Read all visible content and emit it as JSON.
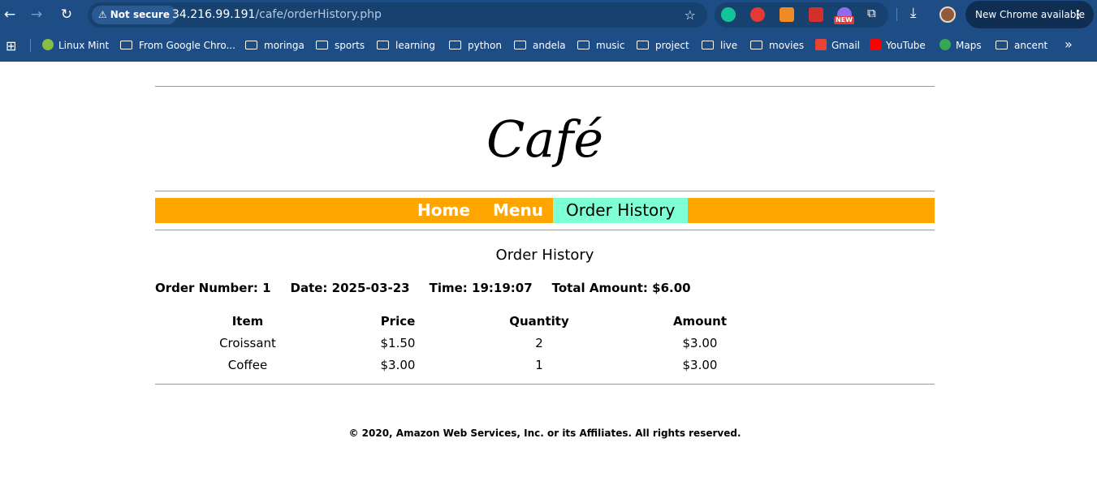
{
  "browser": {
    "security_label": "Not secure",
    "url_host": "34.216.99.191",
    "url_path": "/cafe/orderHistory.php",
    "ext_new_badge": "NEW",
    "update_label": "New Chrome available",
    "bookmarks": [
      {
        "label": "Linux Mint",
        "icon": "linux-mint-icon"
      },
      {
        "label": "From Google Chro...",
        "icon": "folder-icon"
      },
      {
        "label": "moringa",
        "icon": "folder-icon"
      },
      {
        "label": "sports",
        "icon": "folder-icon"
      },
      {
        "label": "learning",
        "icon": "folder-icon"
      },
      {
        "label": "python",
        "icon": "folder-icon"
      },
      {
        "label": "andela",
        "icon": "folder-icon"
      },
      {
        "label": "music",
        "icon": "folder-icon"
      },
      {
        "label": "project",
        "icon": "folder-icon"
      },
      {
        "label": "live",
        "icon": "folder-icon"
      },
      {
        "label": "movies",
        "icon": "folder-icon"
      },
      {
        "label": "Gmail",
        "icon": "gmail-icon"
      },
      {
        "label": "YouTube",
        "icon": "youtube-icon"
      },
      {
        "label": "Maps",
        "icon": "maps-icon"
      },
      {
        "label": "ancent",
        "icon": "folder-icon"
      }
    ]
  },
  "site": {
    "title": "Café",
    "nav": [
      {
        "label": "Home",
        "active": false
      },
      {
        "label": "Menu",
        "active": false
      },
      {
        "label": "Order History",
        "active": true
      }
    ],
    "nav_color": "#ffa500",
    "nav_active_color": "#7fffd4"
  },
  "main": {
    "section_title": "Order History",
    "order": {
      "number": "Order Number: 1",
      "date": "Date: 2025-03-23",
      "time": "Time: 19:19:07",
      "total": "Total Amount: $6.00"
    },
    "table": {
      "headers": [
        "Item",
        "Price",
        "Quantity",
        "Amount"
      ],
      "rows": [
        [
          "Croissant",
          "$1.50",
          "2",
          "$3.00"
        ],
        [
          "Coffee",
          "$3.00",
          "1",
          "$3.00"
        ]
      ]
    }
  },
  "footer": {
    "text": "© 2020, Amazon Web Services, Inc. or its Affiliates. All rights reserved."
  }
}
